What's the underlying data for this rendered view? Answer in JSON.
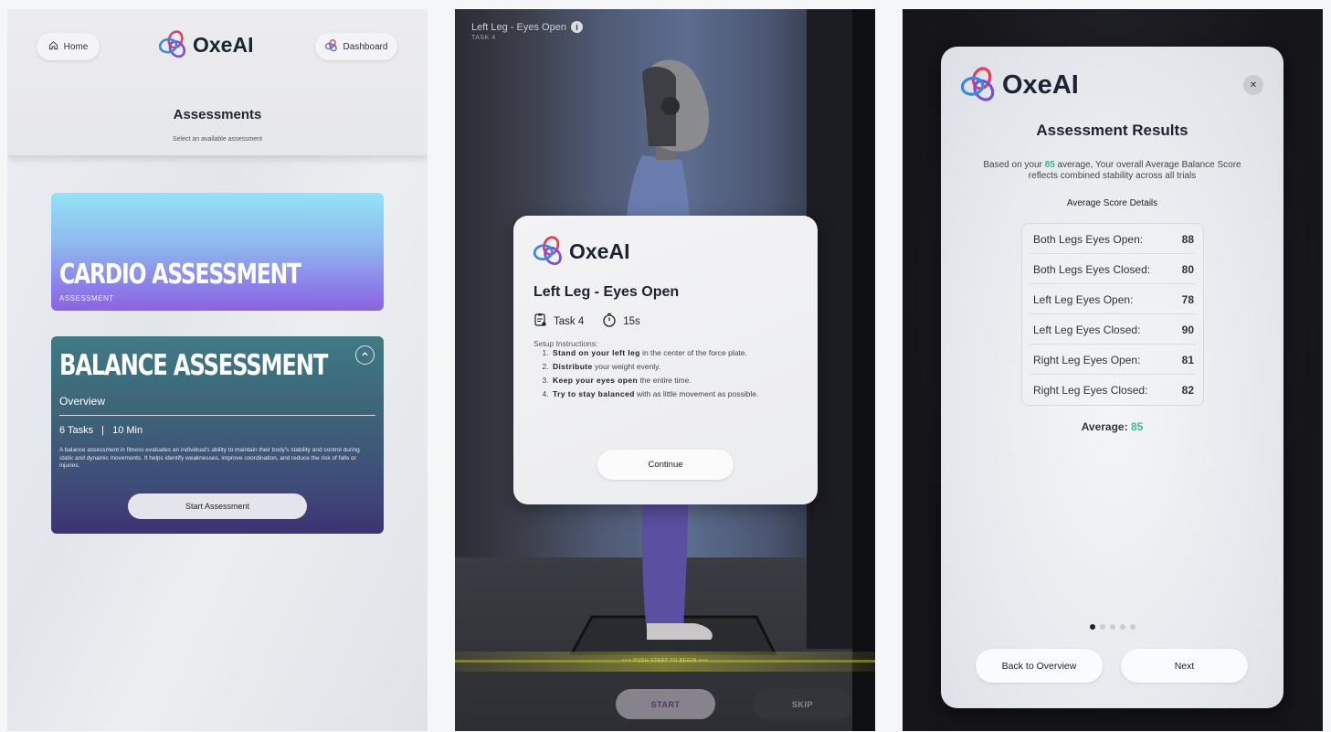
{
  "brand": {
    "name": "OxeAI"
  },
  "panel1": {
    "home_label": "Home",
    "dashboard_label": "Dashboard",
    "title": "Assessments",
    "subtitle": "Select an available assessment",
    "cardio": {
      "title": "CARDIO ASSESSMENT",
      "tag": "ASSESSMENT"
    },
    "balance": {
      "title": "BALANCE ASSESSMENT",
      "overview_label": "Overview",
      "tasks": "6 Tasks",
      "separator": "|",
      "duration": "10 Min",
      "description": "A balance assessment in fitness evaluates an individual's ability to maintain their body's stability and control during static and dynamic movements. It helps identify weaknesses, improve coordination, and reduce the risk of falls or injuries.",
      "start_label": "Start Assessment"
    }
  },
  "panel2": {
    "task_title": "Left Leg - Eyes Open",
    "task_number": "TASK 4",
    "push_text": ">>> PUSH START TO BEGIN <<<",
    "start_label": "START",
    "skip_label": "SKIP",
    "modal": {
      "heading": "Left Leg - Eyes Open",
      "task_label": "Task 4",
      "time_label": "15s",
      "setup_label": "Setup Instructions:",
      "steps": [
        {
          "bold": "Stand on your left leg",
          "rest": " in the center of the force plate."
        },
        {
          "bold": "Distribute",
          "rest": " your weight evenly."
        },
        {
          "bold": "Keep your eyes open",
          "rest": " the entire time."
        },
        {
          "bold": "Try to stay balanced",
          "rest": " with as little movement as possible."
        }
      ],
      "continue_label": "Continue"
    }
  },
  "panel3": {
    "heading": "Assessment Results",
    "summary_pre": "Based on your ",
    "summary_value": "85",
    "summary_post": " average, Your overall Average Balance Score reflects combined stability across all trials",
    "details_label": "Average Score Details",
    "scores": [
      {
        "label": "Both Legs Eyes Open:",
        "value": "88"
      },
      {
        "label": "Both Legs Eyes Closed:",
        "value": "80"
      },
      {
        "label": "Left Leg Eyes Open:",
        "value": "78"
      },
      {
        "label": "Left Leg Eyes Closed:",
        "value": "90"
      },
      {
        "label": "Right Leg Eyes Open:",
        "value": "81"
      },
      {
        "label": "Right Leg Eyes Closed:",
        "value": "82"
      }
    ],
    "average_label": "Average:",
    "average_value": "85",
    "page_indicator": {
      "total": 5,
      "active": 1
    },
    "back_label": "Back to Overview",
    "next_label": "Next"
  },
  "colors": {
    "accent_green": "#3dbb8a",
    "navy": "#1d2233"
  },
  "icons": [
    "home-icon",
    "oxeai-logo-icon",
    "chevron-up-icon",
    "info-icon",
    "clipboard-icon",
    "stopwatch-icon",
    "close-icon"
  ]
}
